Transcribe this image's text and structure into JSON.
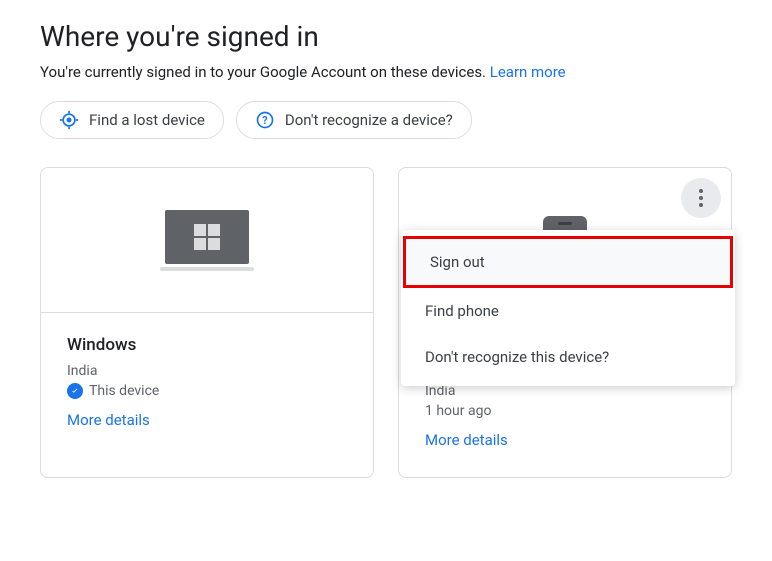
{
  "header": {
    "title": "Where you're signed in",
    "subtitle_prefix": "You're currently signed in to your Google Account on these devices. ",
    "learn_more": "Learn more"
  },
  "chips": {
    "find_device": "Find a lost device",
    "dont_recognize": "Don't recognize a device?"
  },
  "cards": {
    "windows": {
      "name": "Windows",
      "location": "India",
      "this_device": "This device",
      "more_details": "More details"
    },
    "phone": {
      "location": "India",
      "last_seen": "1 hour ago",
      "more_details": "More details"
    }
  },
  "menu": {
    "sign_out": "Sign out",
    "find_phone": "Find phone",
    "dont_recognize": "Don't recognize this device?"
  }
}
